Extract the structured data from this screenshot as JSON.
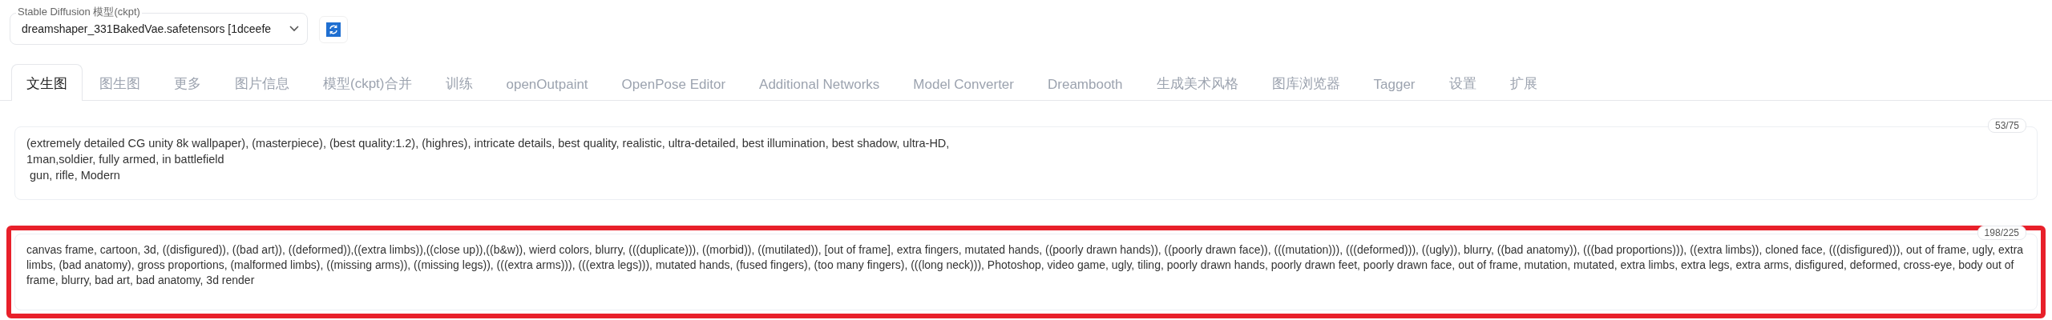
{
  "model_select": {
    "label": "Stable Diffusion 模型(ckpt)",
    "value": "dreamshaper_331BakedVae.safetensors [1dceefe"
  },
  "tabs": [
    {
      "label": "文生图",
      "selected": true
    },
    {
      "label": "图生图",
      "selected": false
    },
    {
      "label": "更多",
      "selected": false
    },
    {
      "label": "图片信息",
      "selected": false
    },
    {
      "label": "模型(ckpt)合并",
      "selected": false
    },
    {
      "label": "训练",
      "selected": false
    },
    {
      "label": "openOutpaint",
      "selected": false
    },
    {
      "label": "OpenPose Editor",
      "selected": false
    },
    {
      "label": "Additional Networks",
      "selected": false
    },
    {
      "label": "Model Converter",
      "selected": false
    },
    {
      "label": "Dreambooth",
      "selected": false
    },
    {
      "label": "生成美术风格",
      "selected": false
    },
    {
      "label": "图库浏览器",
      "selected": false
    },
    {
      "label": "Tagger",
      "selected": false
    },
    {
      "label": "设置",
      "selected": false
    },
    {
      "label": "扩展",
      "selected": false
    }
  ],
  "prompt": {
    "counter": "53/75",
    "value": "(extremely detailed CG unity 8k wallpaper), (masterpiece), (best quality:1.2), (highres), intricate details, best quality, realistic, ultra-detailed, best illumination, best shadow, ultra-HD,\n1man,soldier, fully armed, in battlefield\n gun, rifle, Modern",
    "highlighted": false
  },
  "negative_prompt": {
    "counter": "198/225",
    "value": "canvas frame, cartoon, 3d, ((disfigured)), ((bad art)), ((deformed)),((extra limbs)),((close up)),((b&w)), wierd colors, blurry, (((duplicate))), ((morbid)), ((mutilated)), [out of frame], extra fingers, mutated hands, ((poorly drawn hands)), ((poorly drawn face)), (((mutation))), (((deformed))), ((ugly)), blurry, ((bad anatomy)), (((bad proportions))), ((extra limbs)), cloned face, (((disfigured))), out of frame, ugly, extra limbs, (bad anatomy), gross proportions, (malformed limbs), ((missing arms)), ((missing legs)), (((extra arms))), (((extra legs))), mutated hands, (fused fingers), (too many fingers), (((long neck))), Photoshop, video game, ugly, tiling, poorly drawn hands, poorly drawn feet, poorly drawn face, out of frame, mutation, mutated, extra limbs, extra legs, extra arms, disfigured, deformed, cross-eye, body out of frame, blurry, bad art, bad anatomy, 3d render",
    "highlighted": true
  }
}
